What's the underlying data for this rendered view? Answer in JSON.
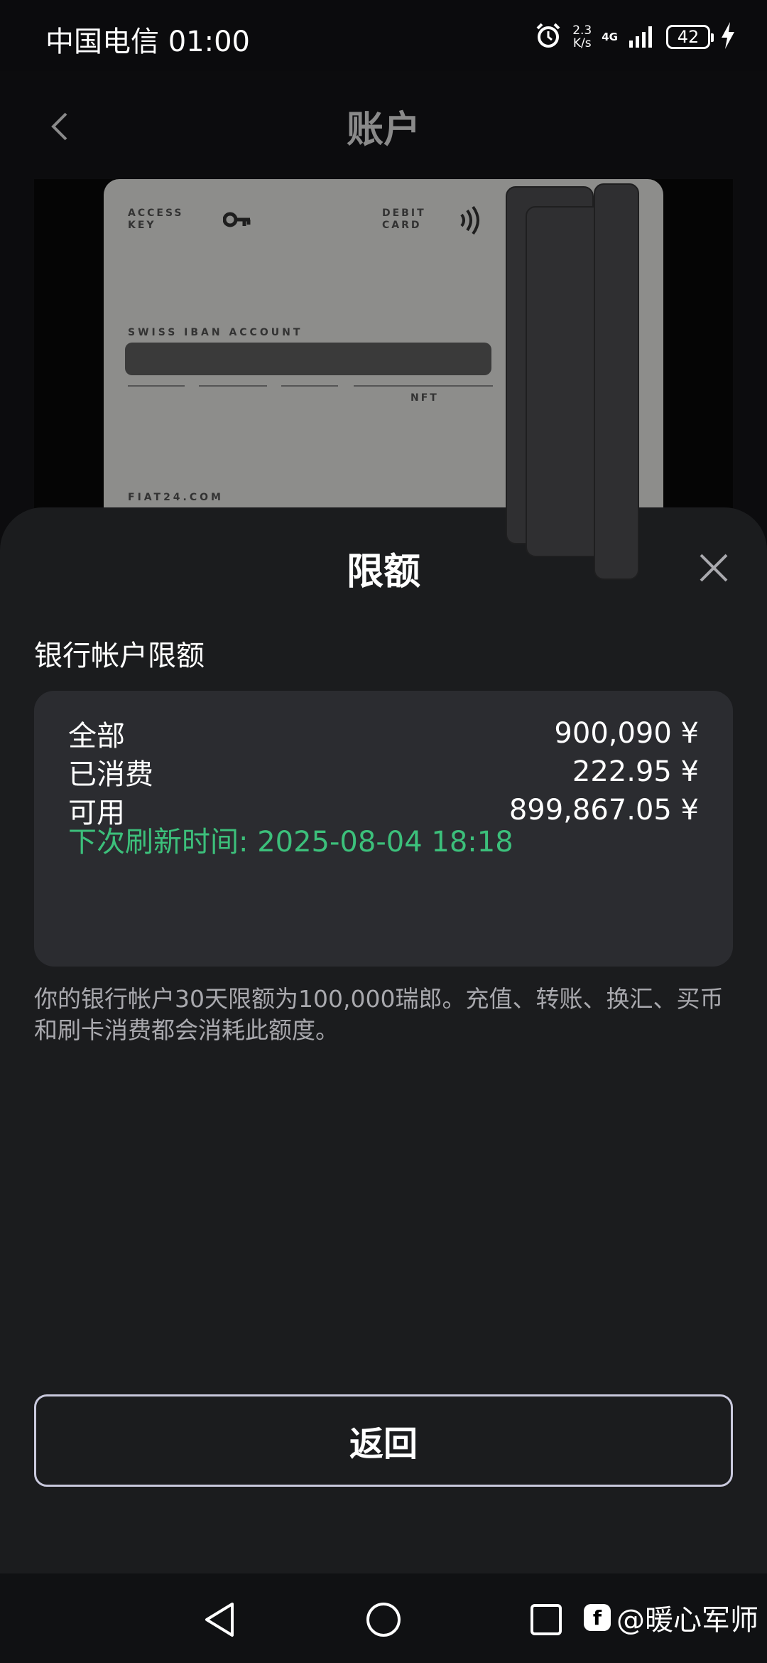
{
  "status_bar": {
    "carrier_time": "中国电信 01:00",
    "speed_value": "2.3",
    "speed_unit": "K/s",
    "network": "4G",
    "battery": "42",
    "icons": [
      "alarm-icon",
      "signal-icon",
      "battery-icon",
      "charging-icon"
    ]
  },
  "header": {
    "title": "账户",
    "back_icon": "chevron-left-icon"
  },
  "card": {
    "access_key": [
      "ACCESS",
      "KEY"
    ],
    "debit_card": [
      "DEBIT",
      "CARD"
    ],
    "iban_label": "SWISS IBAN ACCOUNT",
    "nft_label": "NFT",
    "website": "FIAT24.COM"
  },
  "sheet": {
    "title": "限额",
    "close_icon": "close-icon",
    "section_label": "银行帐户限额",
    "rows": [
      {
        "label": "全部",
        "value": "900,090 ¥"
      },
      {
        "label": "已消费",
        "value": "222.95 ¥"
      },
      {
        "label": "可用",
        "value": "899,867.05 ¥"
      }
    ],
    "refresh_text": "下次刷新时间: 2025-08-04 18:18",
    "note": "你的银行帐户30天限额为100,000瑞郎。充值、转账、换汇、买币和刷卡消费都会消耗此额度。",
    "return_label": "返回"
  },
  "navbar": {
    "icons": [
      "back-triangle-icon",
      "home-circle-icon",
      "recents-square-icon"
    ]
  },
  "watermark": {
    "text": "@暖心军师"
  },
  "colors": {
    "sheet_bg": "#1b1c1e",
    "card_bg": "#2b2c30",
    "accent_green": "#3cc07b",
    "note_gray": "#a9a9ae",
    "button_border": "#c9c9dd"
  }
}
